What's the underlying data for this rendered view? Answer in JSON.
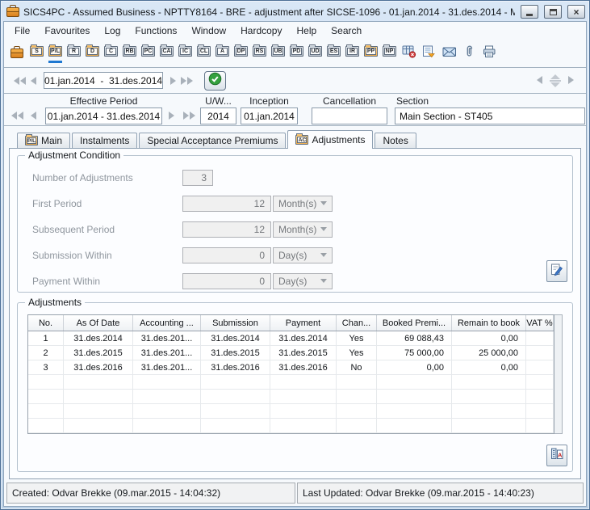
{
  "window": {
    "title": "SICS4PC - Assumed Business - NPTTY8164 - BRE - adjustment after SICSE-1096 - 01.jan.2014  -  31.des.2014 - M...",
    "icon": "briefcase-icon",
    "controls": [
      "minimize",
      "maximize",
      "close"
    ]
  },
  "colors": {
    "active_accent": "#1f78d1",
    "folder_orange": "#f3b04e",
    "check_green": "#35a13f"
  },
  "menu_bar": {
    "items": [
      "File",
      "Favourites",
      "Log",
      "Functions",
      "Window",
      "Hardcopy",
      "Help",
      "Search"
    ]
  },
  "toolbar": {
    "main_icon": "briefcase-icon",
    "folder_buttons": [
      {
        "label": "S",
        "color": "orange",
        "active": false
      },
      {
        "label": "P/L",
        "color": "orange",
        "active": true
      },
      {
        "label": "R",
        "color": "gray",
        "active": false
      },
      {
        "label": "D",
        "color": "orange",
        "active": false
      },
      {
        "label": "C",
        "color": "gray",
        "active": false
      },
      {
        "label": "RB",
        "color": "gray",
        "active": false
      },
      {
        "label": "PC",
        "color": "gray",
        "active": false
      },
      {
        "label": "CA",
        "color": "gray",
        "active": false
      },
      {
        "label": "IC",
        "color": "gray",
        "active": false
      },
      {
        "label": "CL",
        "color": "gray",
        "active": false
      },
      {
        "label": "A",
        "color": "gray",
        "active": false
      },
      {
        "label": "DP",
        "color": "gray",
        "active": false
      },
      {
        "label": "RS",
        "color": "gray",
        "active": false
      },
      {
        "label": "UB",
        "color": "gray",
        "active": false
      },
      {
        "label": "PD",
        "color": "gray",
        "active": false
      },
      {
        "label": "UD",
        "color": "gray",
        "active": false
      },
      {
        "label": "ES",
        "color": "gray",
        "active": false
      },
      {
        "label": "IR",
        "color": "gray",
        "active": false
      },
      {
        "label": "PP",
        "color": "orange",
        "active": false
      },
      {
        "label": "NP",
        "color": "gray",
        "active": false
      }
    ],
    "icon_buttons": [
      "delete-record",
      "log-list",
      "mail",
      "attachments",
      "print"
    ]
  },
  "record_nav": {
    "period_value": "01.jan.2014  -  31.des.2014",
    "confirm_icon": "check-circle"
  },
  "header_fields": {
    "effective_period": {
      "label": "Effective Period",
      "value": "01.jan.2014 - 31.des.2014"
    },
    "uw_year": {
      "label": "U/W...",
      "value": "2014"
    },
    "inception": {
      "label": "Inception",
      "value": "01.jan.2014"
    },
    "cancellation": {
      "label": "Cancellation",
      "value": ""
    },
    "section": {
      "label": "Section",
      "value": "Main Section - ST405"
    }
  },
  "tabs": [
    {
      "label": "Main",
      "icon": "P/L",
      "active": false
    },
    {
      "label": "Instalments",
      "icon": null,
      "active": false
    },
    {
      "label": "Special Acceptance Premiums",
      "icon": null,
      "active": false
    },
    {
      "label": "Adjustments",
      "icon": "AC",
      "active": true
    },
    {
      "label": "Notes",
      "icon": null,
      "active": false
    }
  ],
  "adjustment_condition": {
    "title": "Adjustment Condition",
    "fields": [
      {
        "label": "Number of Adjustments",
        "value": "3",
        "unit": null
      },
      {
        "label": "First Period",
        "value": "12",
        "unit": "Month(s)"
      },
      {
        "label": "Subsequent Period",
        "value": "12",
        "unit": "Month(s)"
      },
      {
        "label": "Submission Within",
        "value": "0",
        "unit": "Day(s)"
      },
      {
        "label": "Payment Within",
        "value": "0",
        "unit": "Day(s)"
      }
    ],
    "edit_button_icon": "edit-note"
  },
  "adjustments": {
    "title": "Adjustments",
    "columns": [
      "No.",
      "As Of Date",
      "Accounting ...",
      "Submission",
      "Payment",
      "Chan...",
      "Booked Premi...",
      "Remain to book",
      "VAT %"
    ],
    "rows": [
      [
        "1",
        "31.des.2014",
        "31.des.201...",
        "31.des.2014",
        "31.des.2014",
        "Yes",
        "69 088,43",
        "0,00",
        ""
      ],
      [
        "2",
        "31.des.2015",
        "31.des.201...",
        "31.des.2015",
        "31.des.2015",
        "Yes",
        "75 000,00",
        "25 000,00",
        ""
      ],
      [
        "3",
        "31.des.2016",
        "31.des.201...",
        "31.des.2016",
        "31.des.2016",
        "No",
        "0,00",
        "0,00",
        ""
      ]
    ],
    "empty_rows": 4,
    "column_setup_icon": "columns-setup"
  },
  "status_bar": {
    "created": "Created: Odvar Brekke (09.mar.2015 - 14:04:32)",
    "last_updated": "Last Updated: Odvar Brekke (09.mar.2015 - 14:40:23)"
  }
}
